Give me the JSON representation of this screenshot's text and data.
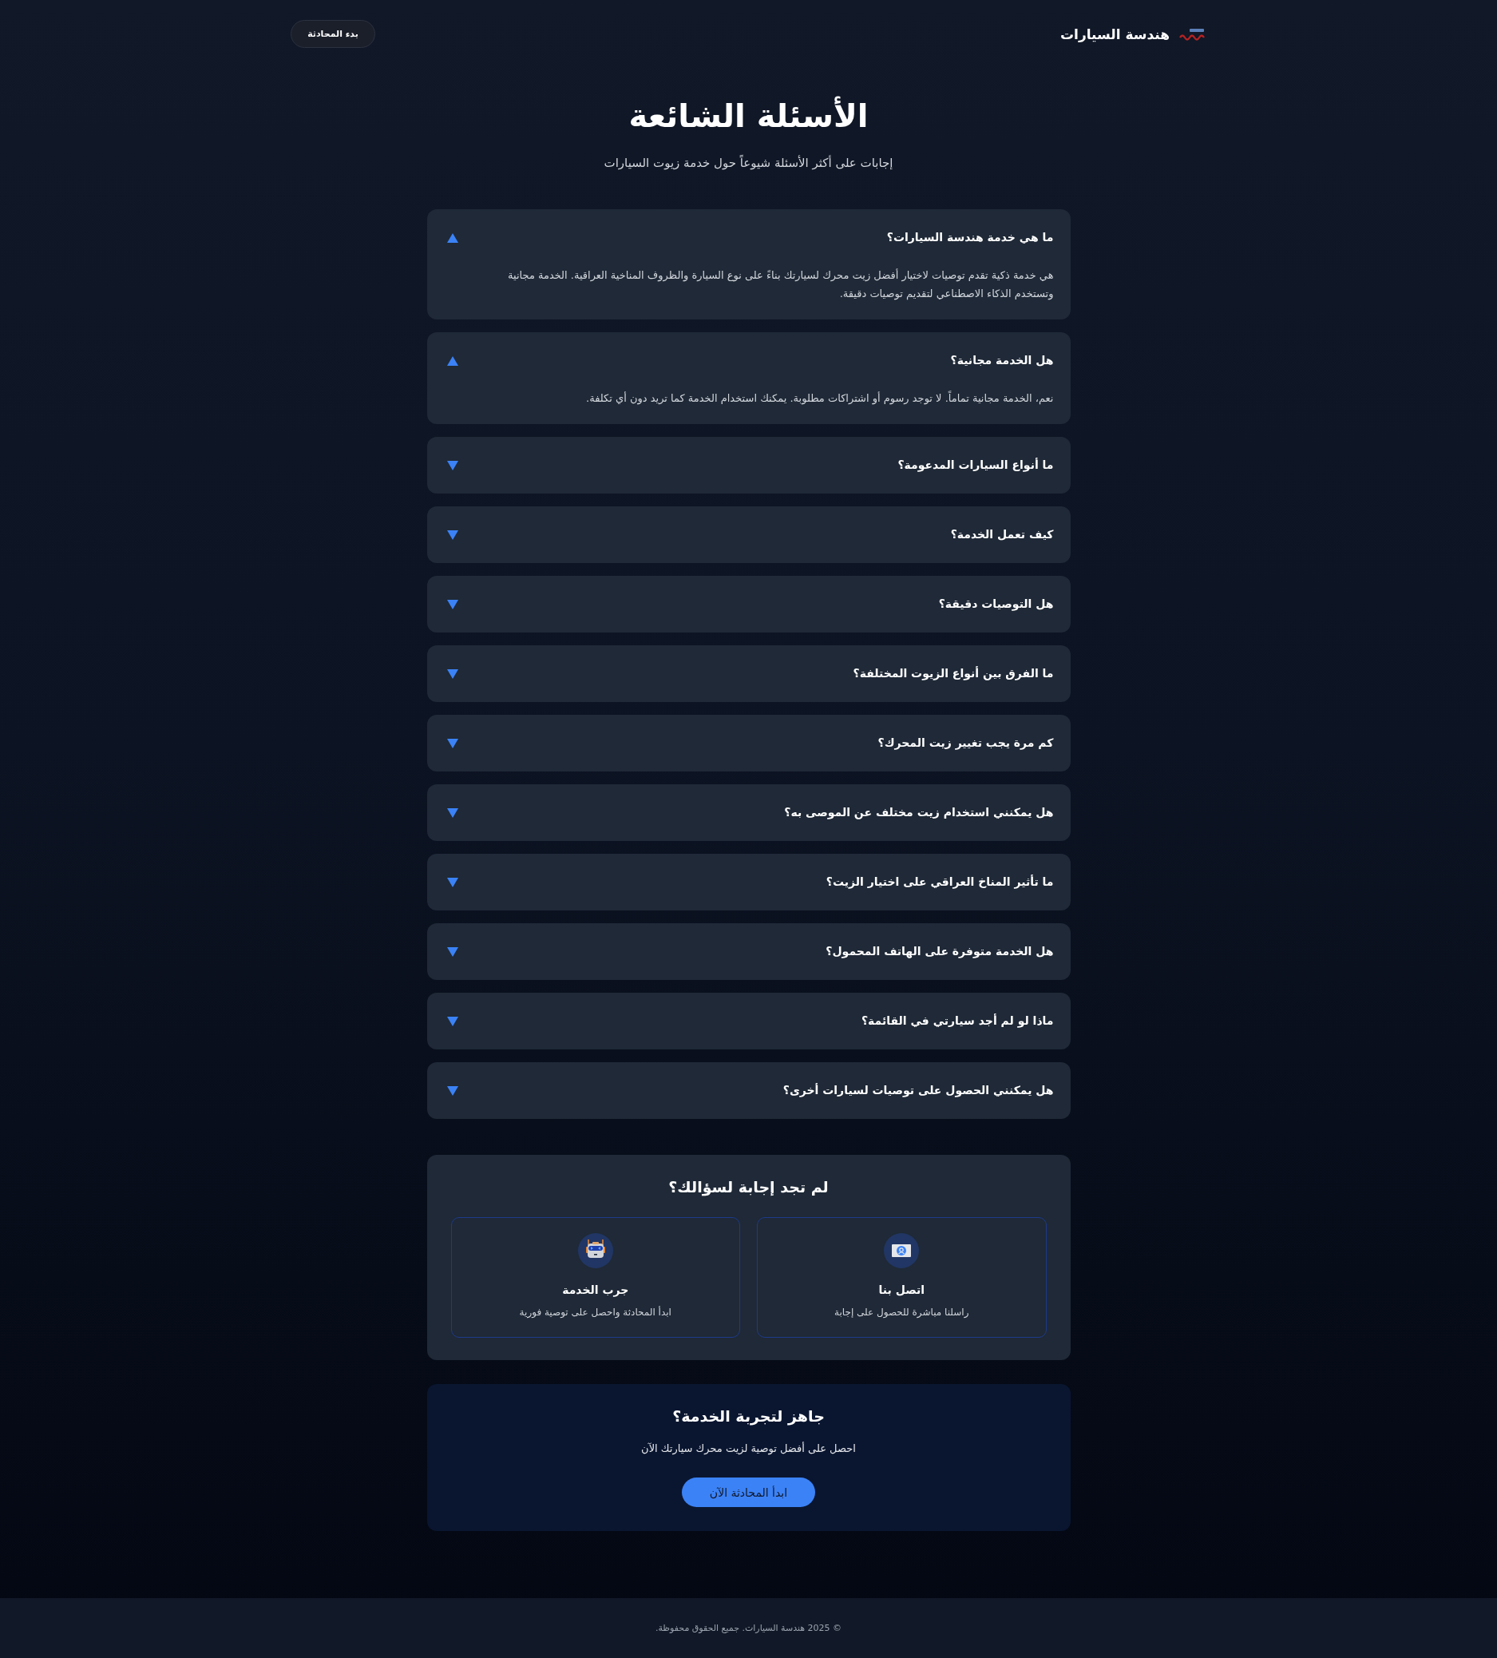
{
  "header": {
    "brand": "هندسة السيارات",
    "button": "بدء المحادثة"
  },
  "hero": {
    "title": "الأسئلة الشائعة",
    "subtitle": "إجابات على أكثر الأسئلة شيوعاً حول خدمة زيوت السيارات"
  },
  "faq": [
    {
      "question": "ما هي خدمة هندسة السيارات؟",
      "expanded": true,
      "answer": "هي خدمة ذكية تقدم توصيات لاختيار أفضل زيت محرك لسيارتك بناءً على نوع السيارة والظروف المناخية العراقية. الخدمة مجانية وتستخدم الذكاء الاصطناعي لتقديم توصيات دقيقة."
    },
    {
      "question": "هل الخدمة مجانية؟",
      "expanded": true,
      "answer": "نعم، الخدمة مجانية تماماً. لا توجد رسوم أو اشتراكات مطلوبة. يمكنك استخدام الخدمة كما تريد دون أي تكلفة."
    },
    {
      "question": "ما أنواع السيارات المدعومة؟",
      "expanded": false
    },
    {
      "question": "كيف تعمل الخدمة؟",
      "expanded": false
    },
    {
      "question": "هل التوصيات دقيقة؟",
      "expanded": false
    },
    {
      "question": "ما الفرق بين أنواع الزيوت المختلفة؟",
      "expanded": false
    },
    {
      "question": "كم مرة يجب تغيير زيت المحرك؟",
      "expanded": false
    },
    {
      "question": "هل يمكنني استخدام زيت مختلف عن الموصى به؟",
      "expanded": false
    },
    {
      "question": "ما تأثير المناخ العراقي على اختيار الزيت؟",
      "expanded": false
    },
    {
      "question": "هل الخدمة متوفرة على الهاتف المحمول؟",
      "expanded": false
    },
    {
      "question": "ماذا لو لم أجد سيارتي في القائمة؟",
      "expanded": false
    },
    {
      "question": "هل يمكنني الحصول على توصيات لسيارات أخرى؟",
      "expanded": false
    }
  ],
  "help": {
    "title": "لم تجد إجابة لسؤالك؟",
    "cards": [
      {
        "kind": "contact",
        "title": "اتصل بنا",
        "text": "راسلنا مباشرة للحصول على إجابة"
      },
      {
        "kind": "demo",
        "title": "جرب الخدمة",
        "text": "ابدأ المحادثة واحصل على توصية فورية"
      }
    ]
  },
  "cta": {
    "title": "جاهز لتجربة الخدمة؟",
    "text": "احصل على أفضل توصية لزيت محرك سيارتك الآن",
    "button": "ابدأ المحادثة الآن"
  },
  "footer": {
    "text": "© 2025 هندسة السيارات. جميع الحقوق محفوظة."
  }
}
